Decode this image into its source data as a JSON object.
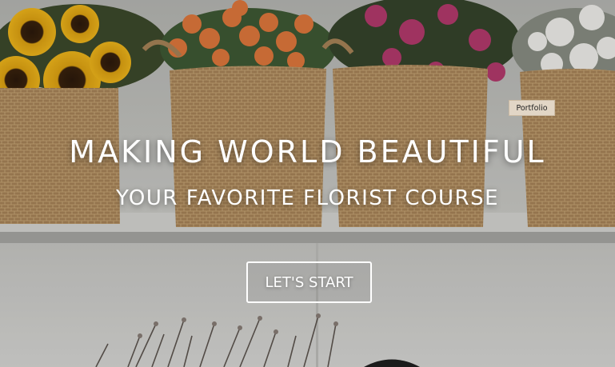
{
  "hero": {
    "badge_label": "Portfolio",
    "headline": "MAKING WORLD BEAUTIFUL",
    "subheadline": "YOUR FAVORITE FLORIST COURSE",
    "cta_label": "LET'S START"
  }
}
